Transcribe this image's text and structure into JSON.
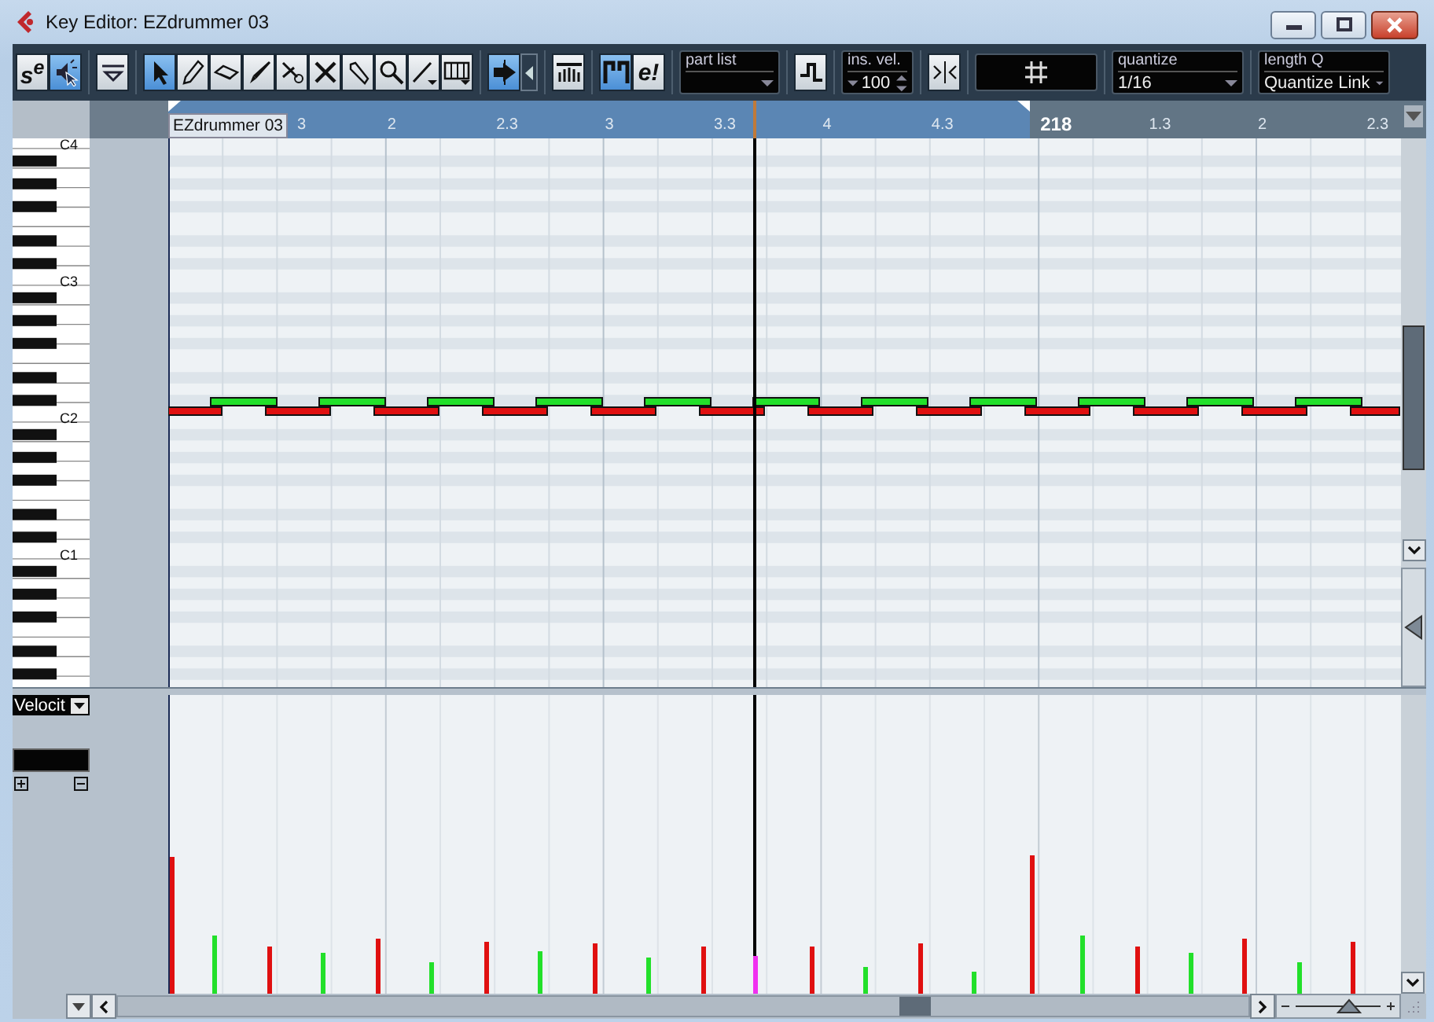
{
  "window": {
    "title": "Key Editor: EZdrummer 03"
  },
  "toolbar": {
    "groups": [
      [
        {
          "kind": "text",
          "label": "s$^{e}$",
          "selected": false
        },
        {
          "kind": "listen",
          "selected": true
        }
      ],
      [
        {
          "kind": "info",
          "selected": false
        }
      ],
      [
        {
          "kind": "arrow",
          "selected": true
        },
        {
          "kind": "pencil",
          "selected": false
        },
        {
          "kind": "eraser",
          "selected": false
        },
        {
          "kind": "brush",
          "selected": false
        },
        {
          "kind": "scissors",
          "selected": false
        },
        {
          "kind": "cross",
          "selected": false
        },
        {
          "kind": "glue",
          "selected": false
        },
        {
          "kind": "magnifier",
          "selected": false
        },
        {
          "kind": "line",
          "selected": false
        },
        {
          "kind": "comb",
          "selected": false
        }
      ],
      [
        {
          "kind": "autoscroll",
          "selected": true
        },
        {
          "kind": "tab"
        }
      ],
      [
        {
          "kind": "ramp",
          "selected": false
        }
      ],
      [
        {
          "kind": "bracket",
          "selected": true
        },
        {
          "kind": "text",
          "label": "e!",
          "selected": false
        }
      ],
      [
        {
          "kind": "dropdown",
          "label": "part list"
        }
      ],
      [
        {
          "kind": "step",
          "selected": false
        }
      ],
      [
        {
          "kind": "spin",
          "label": "ins. vel.",
          "value": "100"
        }
      ],
      [
        {
          "kind": "mirror",
          "selected": false
        }
      ],
      [
        {
          "kind": "display"
        }
      ],
      [
        {
          "kind": "dropdown",
          "label": "quantize",
          "value": "1/16"
        }
      ],
      [
        {
          "kind": "dropdown",
          "label": "length Q",
          "value": "Quantize Link"
        }
      ]
    ]
  },
  "ruler": {
    "part_name": "EZdrummer 03",
    "labels": [
      {
        "text": "3",
        "bold": false
      },
      {
        "text": "2",
        "bold": false
      },
      {
        "text": "2.3",
        "bold": false
      },
      {
        "text": "3",
        "bold": false
      },
      {
        "text": "3.3",
        "bold": false
      },
      {
        "text": "4",
        "bold": false
      },
      {
        "text": "4.3",
        "bold": false
      },
      {
        "text": "218",
        "bold": true
      },
      {
        "text": "1.3",
        "bold": false
      },
      {
        "text": "2",
        "bold": false
      },
      {
        "text": "2.3",
        "bold": false
      }
    ]
  },
  "keyboard": {
    "labels": [
      "C4",
      "C3",
      "C2",
      "C1"
    ]
  },
  "velocity_lane": {
    "controller": "Velocit"
  },
  "zoom": {
    "vertical": {
      "level": 0.5
    },
    "horizontal": {
      "level": 0.55
    }
  }
}
